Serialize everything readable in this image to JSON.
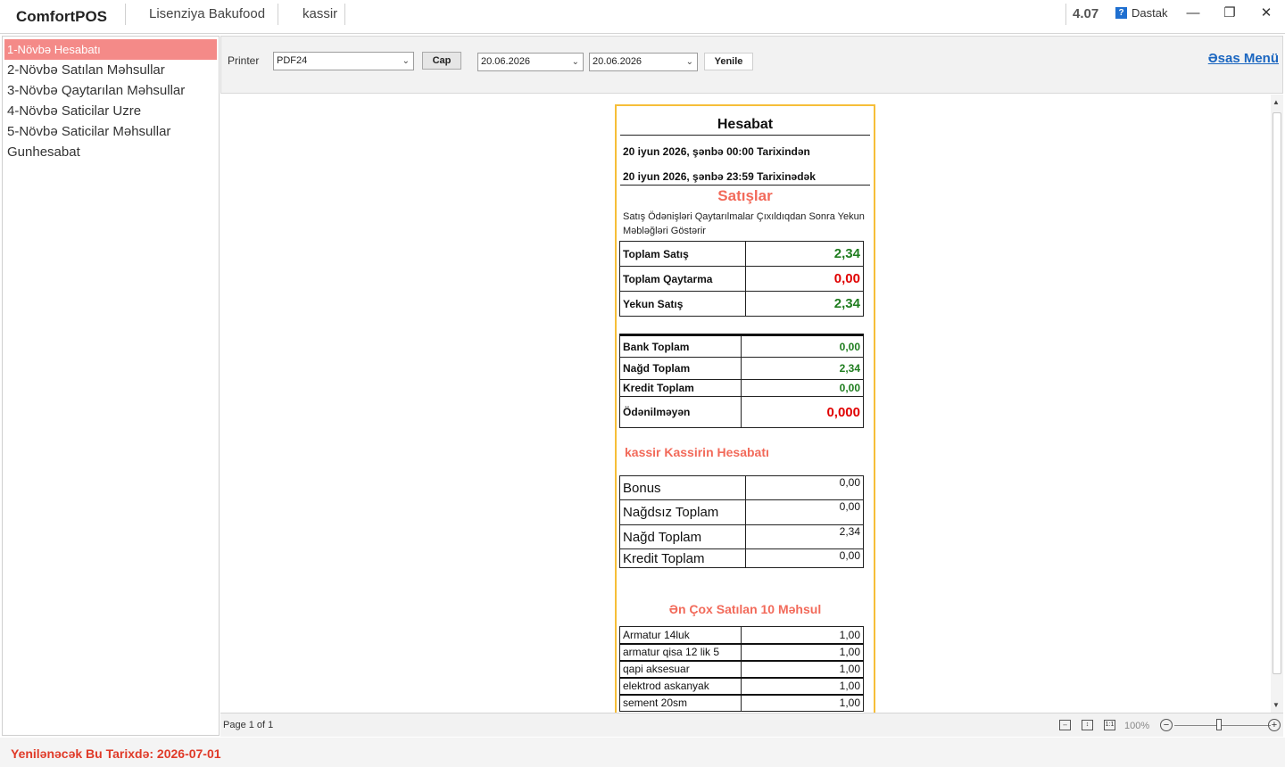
{
  "titlebar": {
    "app_name": "ComfortPOS",
    "license": "Lisenziya Bakufood",
    "user": "kassir",
    "version": "4.07",
    "help_label": "Dastak",
    "minimize": "—",
    "restore": "❐",
    "close": "✕"
  },
  "sidebar": {
    "items": [
      {
        "label": "1-Növbə Hesabatı"
      },
      {
        "label": "2-Növbə Satılan Məhsullar"
      },
      {
        "label": "3-Növbə Qaytarılan Məhsullar"
      },
      {
        "label": "4-Növbə Saticilar Uzre"
      },
      {
        "label": "5-Növbə Saticilar Məhsullar"
      },
      {
        "label": "Gunhesabat"
      }
    ]
  },
  "toolbar": {
    "printer_label": "Printer",
    "printer_value": "PDF24",
    "print_button": "Cap",
    "date_from": "20.06.2026",
    "date_to": "20.06.2026",
    "refresh_button": "Yenile",
    "main_menu_link": "Əsas Menü"
  },
  "report": {
    "title": "Hesabat",
    "from_line": "20 iyun 2026, şənbə 00:00  Tarixindən",
    "to_line": "20 iyun 2026, şənbə 23:59  Tarixinədək",
    "sales_heading": "Satışlar",
    "sales_note": "Satış Ödənişləri Qaytarılmalar Çıxıldıqdan Sonra Yekun Məbləğləri Göstərir",
    "totals": [
      {
        "label": "Toplam Satış",
        "value": "2,34",
        "color": "#1f7d1f"
      },
      {
        "label": "Toplam Qaytarma",
        "value": "0,00",
        "color": "#e00000"
      },
      {
        "label": "Yekun Satış",
        "value": "2,34",
        "color": "#1f7d1f"
      }
    ],
    "payments": [
      {
        "label": "Bank Toplam",
        "value": "0,00"
      },
      {
        "label": "Nağd Toplam",
        "value": "2,34"
      },
      {
        "label": "Kredit Toplam",
        "value": "0,00"
      },
      {
        "label": "Ödənilməyən",
        "value": "0,000"
      }
    ],
    "cashier_heading": "kassir  Kassirin  Hesabatı",
    "cashier_rows": [
      {
        "label": "Bonus",
        "value": "0,00"
      },
      {
        "label": "Nağdsız Toplam",
        "value": "0,00"
      },
      {
        "label": "Nağd Toplam",
        "value": "2,34"
      },
      {
        "label": "Kredit Toplam",
        "value": "0,00"
      }
    ],
    "top_heading": "Ən Çox Satılan 10 Məhsul",
    "top_products": [
      {
        "label": "Armatur 14luk",
        "value": "1,00"
      },
      {
        "label": "armatur qisa 12 lik 5",
        "value": "1,00"
      },
      {
        "label": "qapi aksesuar",
        "value": "1,00"
      },
      {
        "label": "elektrod askanyak",
        "value": "1,00"
      },
      {
        "label": "sement 20sm",
        "value": "1,00"
      }
    ]
  },
  "viewer_status": {
    "page_info": "Page 1 of 1",
    "zoom": "100%"
  },
  "status": {
    "update_text": "Yenilənəcək Bu Tarixdə: 2026-07-01"
  },
  "colors": {
    "accent_red": "#f26a5a",
    "active_menu": "#f48a88",
    "page_border": "#f6be38",
    "link_blue": "#1b66c0"
  }
}
